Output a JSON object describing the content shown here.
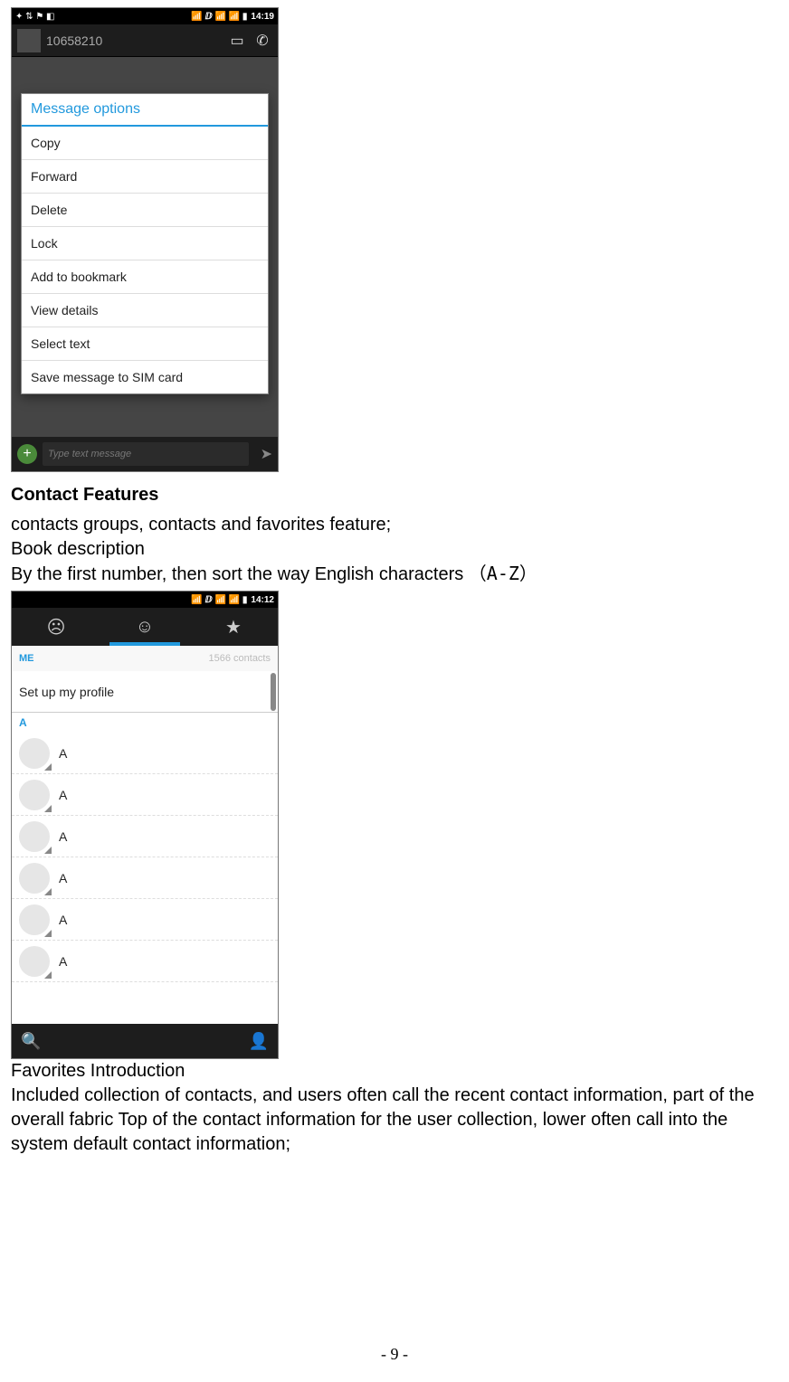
{
  "screenshot1": {
    "statusbar": {
      "time": "14:19",
      "left_glyphs": "✦ ⇅ ⚑ ◧",
      "right_glyphs": "📶 ⅅ 📶 📶 ▮"
    },
    "header": {
      "number": "10658210",
      "contact_icon": "contact-card-icon",
      "call_icon": "phone-icon"
    },
    "menu": {
      "title": "Message options",
      "items": [
        "Copy",
        "Forward",
        "Delete",
        "Lock",
        "Add to bookmark",
        "View details",
        "Select text",
        "Save message to SIM card"
      ]
    },
    "composer": {
      "placeholder": "Type text message",
      "add": "+",
      "send": "➤"
    }
  },
  "text": {
    "heading1": "Contact Features",
    "p1": "contacts groups, contacts and favorites feature;",
    "p2": "Book description",
    "p3a": "By the first number, then sort the way English characters  ",
    "p3b": "（A-Z）",
    "favintro": "Favorites Introduction",
    "favbody": "Included collection of contacts, and users often call the recent contact information, part of the overall fabric Top of the contact information for the user collection, lower often call into the system default contact information;"
  },
  "screenshot2": {
    "statusbar": {
      "time": "14:12",
      "left_glyphs": "",
      "right_glyphs": "📶 ⅅ 📶 📶 ▮"
    },
    "tabs": {
      "groups": "☹",
      "person": "☺",
      "star": "★"
    },
    "me_label": "ME",
    "count_label": "1566 contacts",
    "profile_row": "Set up my profile",
    "section_letter": "A",
    "rows": [
      "A",
      "A",
      "A",
      "A",
      "A",
      "A"
    ],
    "search_glyph": "🔍",
    "addcontact_glyph": "👤"
  },
  "page_number": "- 9 -"
}
